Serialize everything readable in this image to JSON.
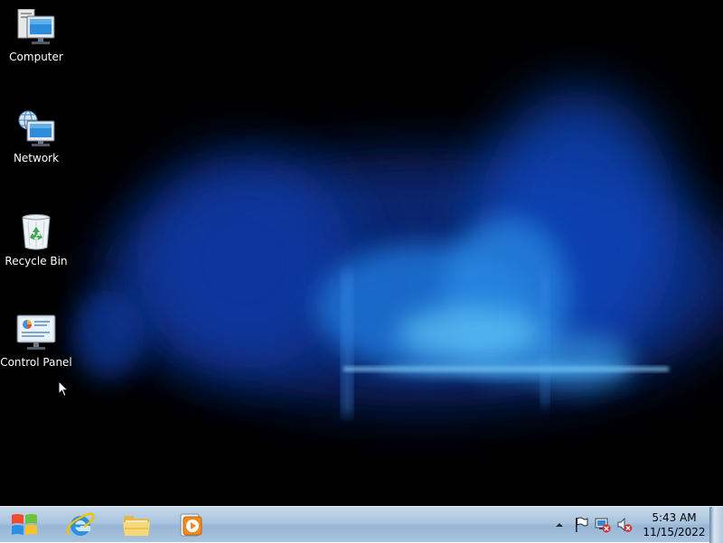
{
  "desktop": {
    "icons": [
      {
        "label": "Computer",
        "icon": "computer-icon"
      },
      {
        "label": "Network",
        "icon": "network-icon"
      },
      {
        "label": "Recycle Bin",
        "icon": "recycle-bin-icon"
      },
      {
        "label": "Control Panel",
        "icon": "control-panel-icon"
      }
    ]
  },
  "taskbar": {
    "pinned": [
      {
        "icon": "windows-start-icon"
      },
      {
        "icon": "internet-explorer-icon"
      },
      {
        "icon": "file-explorer-icon"
      },
      {
        "icon": "media-player-icon"
      }
    ],
    "tray": [
      {
        "icon": "show-hidden-icons-arrow-icon"
      },
      {
        "icon": "action-center-flag-icon"
      },
      {
        "icon": "network-status-icon"
      },
      {
        "icon": "volume-muted-icon"
      }
    ],
    "clock": {
      "time": "5:43 AM",
      "date": "11/15/2022"
    }
  },
  "colors": {
    "aurora": "#1a5fd0",
    "taskbar": "#a9c4de"
  }
}
